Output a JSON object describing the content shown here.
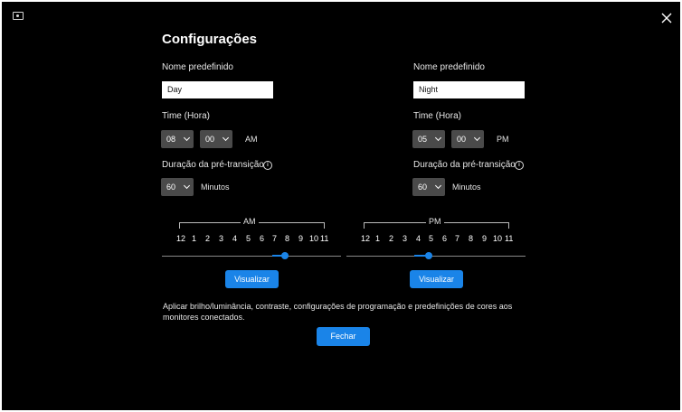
{
  "title": "Configurações",
  "accent": "#1a84e8",
  "icons": {
    "app": "display-icon",
    "close": "close-icon",
    "info": "info-icon",
    "chevron": "chevron-down-icon"
  },
  "day": {
    "preset_label": "Nome predefinido",
    "preset_value": "Day",
    "time_label": "Time (Hora)",
    "hour": "08",
    "minute": "00",
    "ampm": "AM",
    "duration_label": "Duração da pré-transição",
    "duration": "60",
    "duration_unit": "Minutos",
    "scale_label": "AM",
    "preview_button": "Visualizar"
  },
  "night": {
    "preset_label": "Nome predefinido",
    "preset_value": "Night",
    "time_label": "Time (Hora)",
    "hour": "05",
    "minute": "00",
    "ampm": "PM",
    "duration_label": "Duração da pré-transição",
    "duration": "60",
    "duration_unit": "Minutos",
    "scale_label": "PM",
    "preview_button": "Visualizar"
  },
  "hours": [
    "12",
    "1",
    "2",
    "3",
    "4",
    "5",
    "6",
    "7",
    "8",
    "9",
    "10",
    "11"
  ],
  "note": "Aplicar brilho/luminância, contraste, configurações de programação e predefinições de cores aos monitores conectados.",
  "close_button": "Fechar"
}
